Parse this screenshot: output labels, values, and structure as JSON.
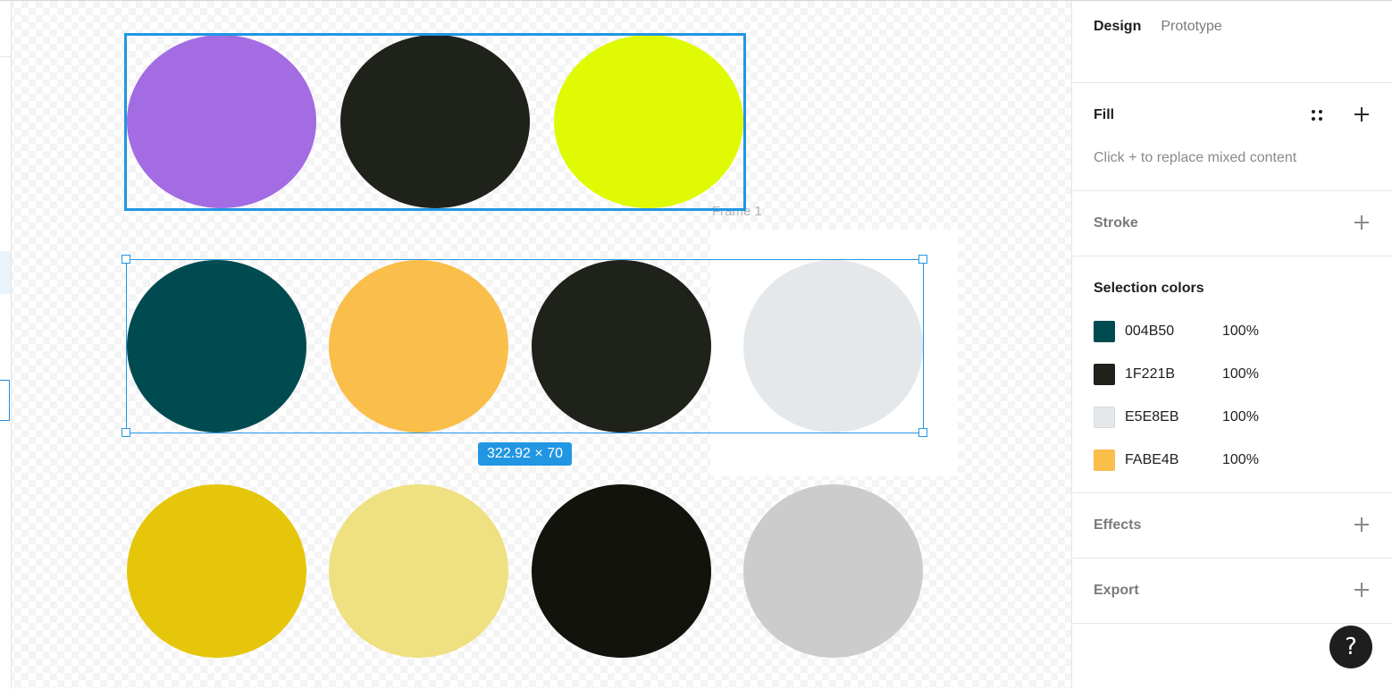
{
  "canvas": {
    "frame_label": "Frame 1",
    "dimension_badge": "322.92 × 70",
    "row1_colors": [
      "#A36CE3",
      "#1F221B",
      "#E0FA03"
    ],
    "row2_colors": [
      "#004B50",
      "#FABE4B",
      "#1F221B",
      "#E5E8EB"
    ],
    "row3_colors": [
      "#E5C60B",
      "#EFE081",
      "#13130D",
      "#CCCCCC"
    ],
    "selection_color": "#2196E3"
  },
  "panel": {
    "tabs": [
      {
        "label": "Design",
        "active": true
      },
      {
        "label": "Prototype",
        "active": false
      }
    ],
    "fill": {
      "title": "Fill",
      "hint": "Click + to replace mixed content",
      "styles_icon": "styles-grid-icon",
      "add_icon": "plus-icon"
    },
    "stroke": {
      "title": "Stroke"
    },
    "selection_colors": {
      "title": "Selection colors",
      "items": [
        {
          "hex": "004B50",
          "opacity": "100%",
          "color": "#004B50"
        },
        {
          "hex": "1F221B",
          "opacity": "100%",
          "color": "#1F221B"
        },
        {
          "hex": "E5E8EB",
          "opacity": "100%",
          "color": "#E5E8EB"
        },
        {
          "hex": "FABE4B",
          "opacity": "100%",
          "color": "#FABE4B"
        }
      ]
    },
    "effects": {
      "title": "Effects"
    },
    "export": {
      "title": "Export"
    }
  },
  "help": {
    "label": "?",
    "icon": "help-icon"
  }
}
